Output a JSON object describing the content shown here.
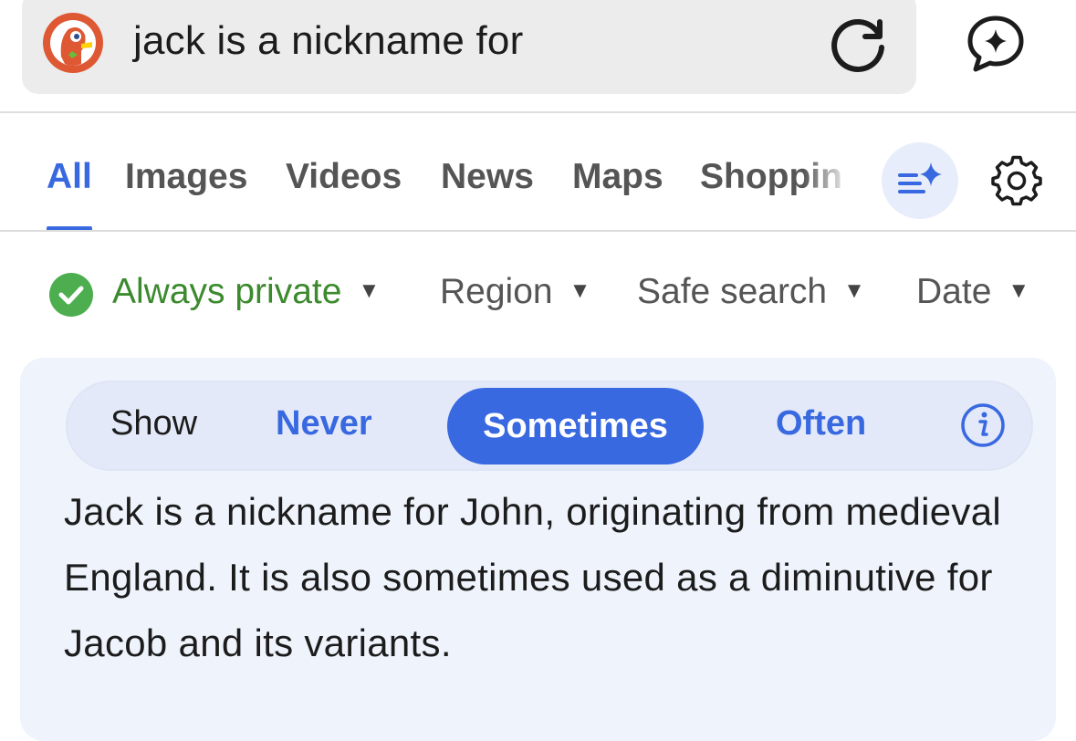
{
  "search": {
    "query": "jack is a nickname for",
    "logo_icon": "duckduckgo-logo",
    "reload_icon": "reload-icon",
    "chat_icon": "ai-chat-icon"
  },
  "tabs": {
    "items": [
      {
        "label": "All",
        "active": true
      },
      {
        "label": "Images",
        "active": false
      },
      {
        "label": "Videos",
        "active": false
      },
      {
        "label": "News",
        "active": false
      },
      {
        "label": "Maps",
        "active": false
      },
      {
        "label": "Shoppin",
        "active": false
      }
    ],
    "ai_assist_icon": "sparkle-list-icon",
    "settings_icon": "gear-icon"
  },
  "filters": {
    "privacy": "Always private",
    "region": "Region",
    "safe_search": "Safe search",
    "date": "Date"
  },
  "assist_card": {
    "toggle": {
      "label": "Show",
      "options": [
        "Never",
        "Sometimes",
        "Often"
      ],
      "selected": "Sometimes"
    },
    "info_icon": "info-icon",
    "answer": "Jack is a nickname for John, originating from medieval England. It is also sometimes used as a diminutive for Jacob and its variants."
  },
  "colors": {
    "accent": "#3969e0",
    "private_green": "#3c8a2e",
    "card_background": "#eef3fc"
  }
}
